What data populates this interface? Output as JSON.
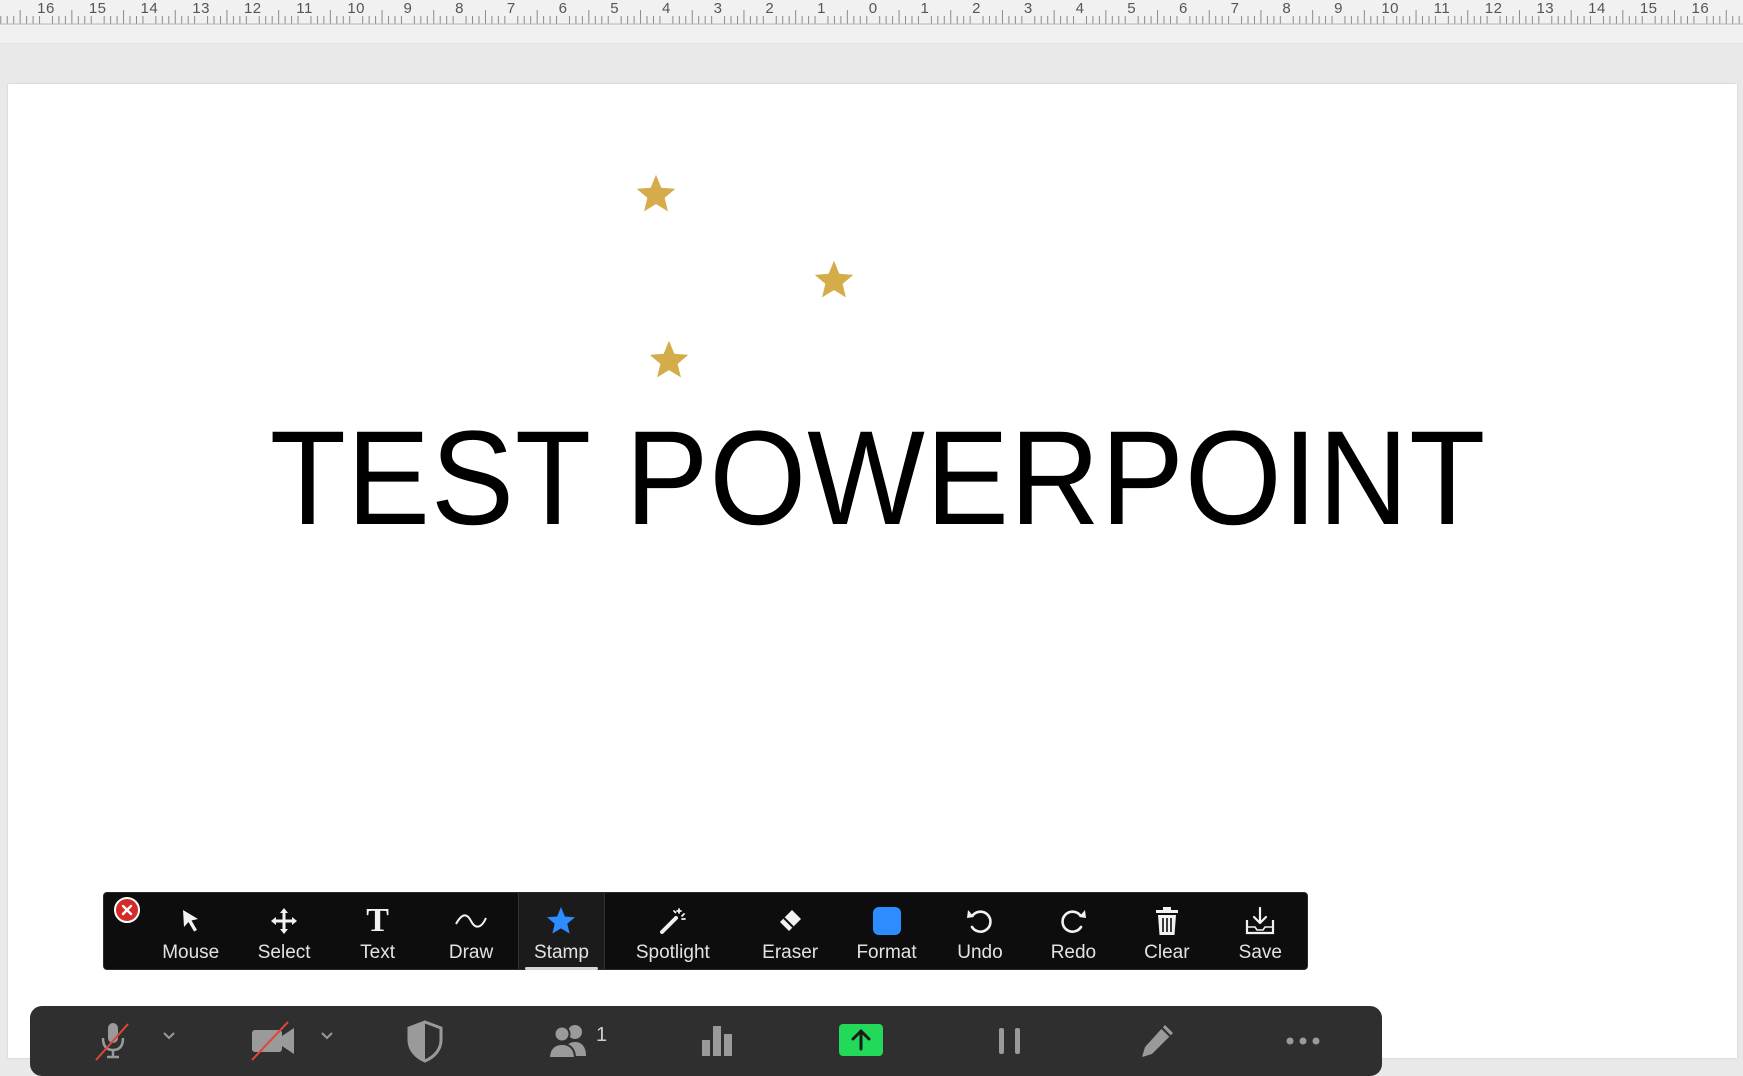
{
  "ruler": {
    "labels": [
      "16",
      "15",
      "14",
      "13",
      "12",
      "11",
      "10",
      "9",
      "8",
      "7",
      "6",
      "5",
      "4",
      "3",
      "2",
      "1",
      "0",
      "1",
      "2",
      "3",
      "4",
      "5",
      "6",
      "7",
      "8",
      "9",
      "10",
      "11",
      "12",
      "13",
      "14",
      "15",
      "16"
    ]
  },
  "slide": {
    "title": "TEST POWERPOINT",
    "stamp_color": "#d4ac4a"
  },
  "annotation_toolbar": {
    "tools": [
      {
        "name": "tool-mouse",
        "label": "Mouse",
        "icon": "cursor-arrow-icon"
      },
      {
        "name": "tool-select",
        "label": "Select",
        "icon": "move-arrows-icon"
      },
      {
        "name": "tool-text",
        "label": "Text",
        "icon": "text-t-icon"
      },
      {
        "name": "tool-draw",
        "label": "Draw",
        "icon": "squiggle-icon"
      },
      {
        "name": "tool-stamp",
        "label": "Stamp",
        "icon": "star-icon",
        "active": true
      },
      {
        "name": "tool-spotlight",
        "label": "Spotlight",
        "icon": "magic-wand-icon"
      },
      {
        "name": "tool-eraser",
        "label": "Eraser",
        "icon": "eraser-icon"
      },
      {
        "name": "tool-format",
        "label": "Format",
        "icon": "color-square-icon"
      },
      {
        "name": "tool-undo",
        "label": "Undo",
        "icon": "undo-icon"
      },
      {
        "name": "tool-redo",
        "label": "Redo",
        "icon": "redo-icon"
      },
      {
        "name": "tool-clear",
        "label": "Clear",
        "icon": "trash-icon"
      },
      {
        "name": "tool-save",
        "label": "Save",
        "icon": "download-tray-icon"
      }
    ],
    "stamp_active_color": "#2d8cff",
    "format_color": "#2d8cff",
    "close_color": "#d42a2a"
  },
  "meeting_bar": {
    "participants_count": "1",
    "share_color": "#23d959",
    "muted_slash_color": "#e0453a"
  }
}
